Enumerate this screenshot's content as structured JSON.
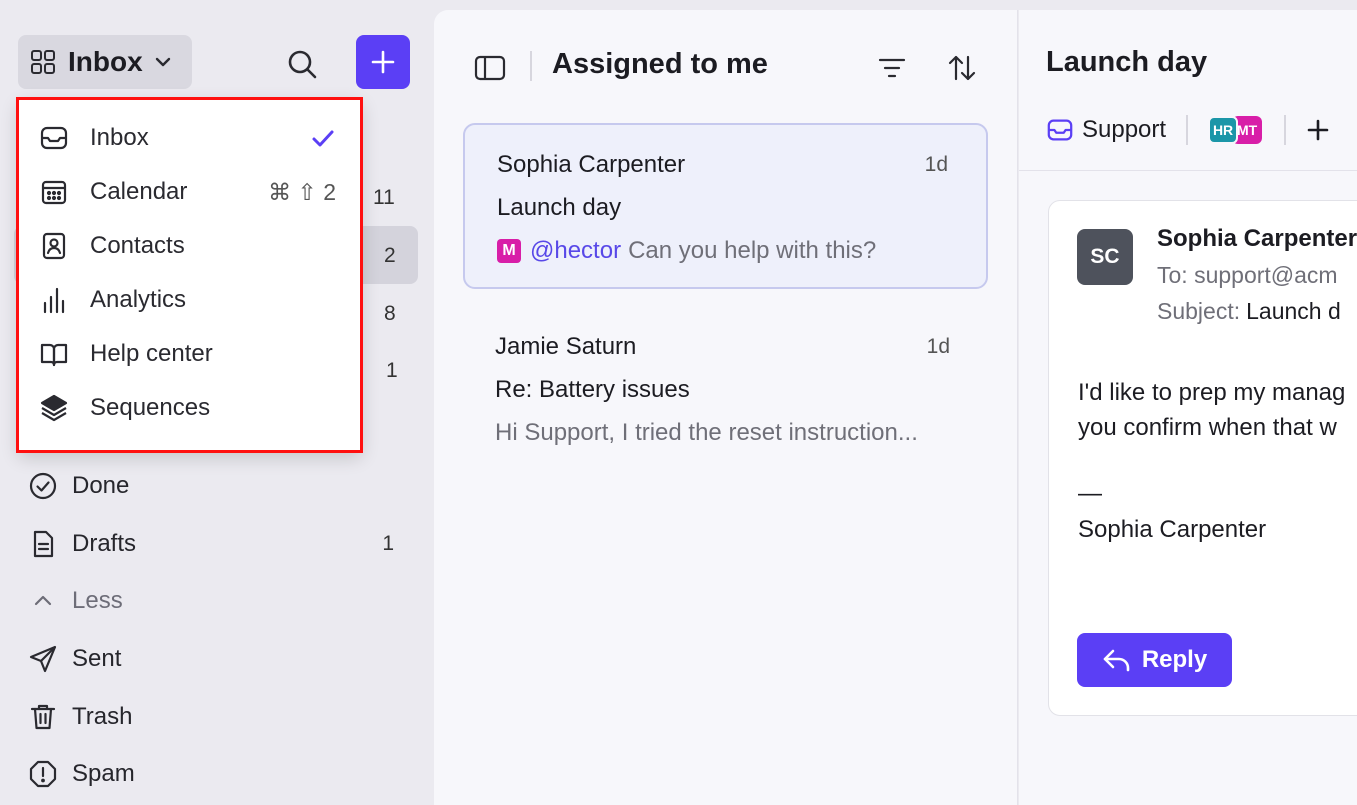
{
  "colors": {
    "accent": "#5b3ff5",
    "mention": "#5848e8",
    "badge_m": "#d81ea8",
    "badge_hr": "#1b96a8",
    "dropdown_outline": "#ff1010"
  },
  "sidebar": {
    "workspace_label": "Inbox",
    "counts": [
      "11",
      "2",
      "8",
      "1"
    ],
    "nav_items": [
      {
        "icon": "check-circle-icon",
        "label": "Done",
        "count": ""
      },
      {
        "icon": "draft-document-icon",
        "label": "Drafts",
        "count": "1"
      },
      {
        "icon": "chevron-up-icon",
        "label": "Less",
        "count": ""
      },
      {
        "icon": "send-icon",
        "label": "Sent",
        "count": ""
      },
      {
        "icon": "trash-icon",
        "label": "Trash",
        "count": ""
      },
      {
        "icon": "spam-icon",
        "label": "Spam",
        "count": ""
      }
    ]
  },
  "dropdown": {
    "items": [
      {
        "icon": "inbox-tray-icon",
        "label": "Inbox",
        "checked": true
      },
      {
        "icon": "calendar-icon",
        "label": "Calendar",
        "shortcut": "⌘ ⇧ 2"
      },
      {
        "icon": "contact-card-icon",
        "label": "Contacts"
      },
      {
        "icon": "bar-chart-icon",
        "label": "Analytics"
      },
      {
        "icon": "open-book-icon",
        "label": "Help center"
      },
      {
        "icon": "layers-icon",
        "label": "Sequences"
      }
    ]
  },
  "list": {
    "title": "Assigned to me",
    "conversations": [
      {
        "from": "Sophia Carpenter",
        "time": "1d",
        "subject": "Launch day",
        "badge": "M",
        "mention": "@hector",
        "preview": "Can you help with this?"
      },
      {
        "from": "Jamie Saturn",
        "time": "1d",
        "subject": "Re: Battery issues",
        "preview": "Hi Support, I tried the reset instruction..."
      }
    ]
  },
  "detail": {
    "title": "Launch day",
    "inbox_label": "Support",
    "assignees": [
      "HR",
      "MT"
    ],
    "message": {
      "avatar_initials": "SC",
      "from": "Sophia Carpenter",
      "to": "To: support@acm",
      "subject_label": "Subject:",
      "subject_value": "Launch d",
      "body_line1": "I'd like to prep my manag",
      "body_line2": "you confirm when that w",
      "dash": "—",
      "signature": "Sophia Carpenter",
      "reply_label": "Reply"
    }
  }
}
